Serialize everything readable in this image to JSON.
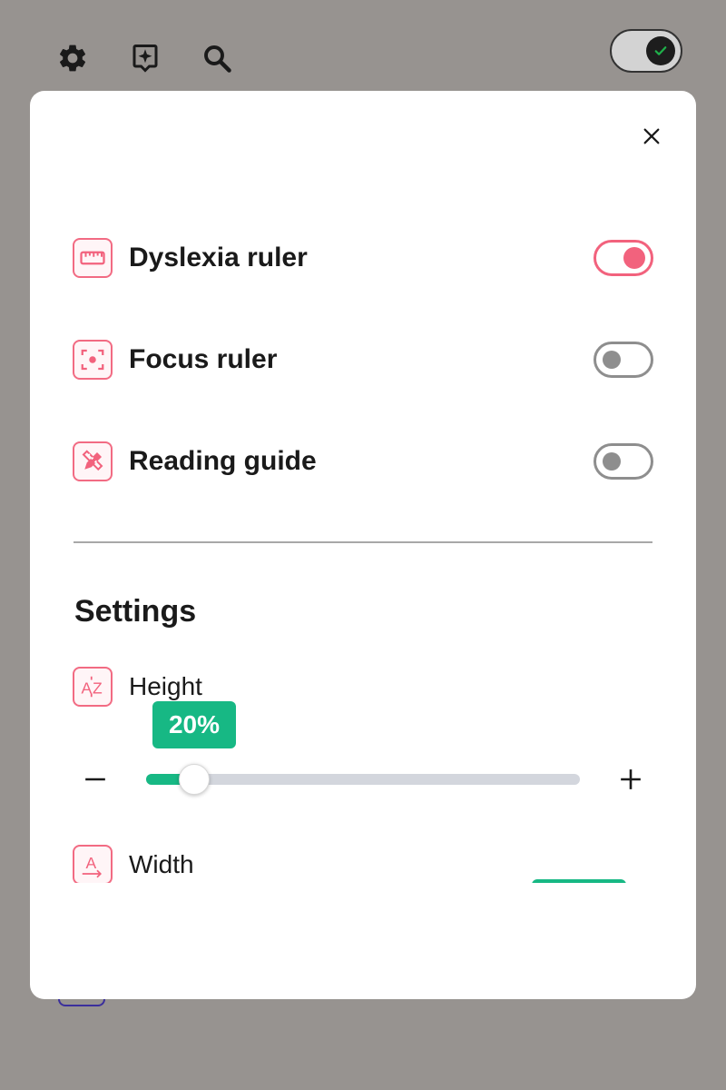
{
  "toolbar": {
    "icons": [
      "gear-icon",
      "sparkle-bubble-icon",
      "search-icon"
    ],
    "main_toggle_state": "on"
  },
  "modal": {
    "close_icon": "close-icon",
    "features": [
      {
        "label": "Dyslexia ruler",
        "icon": "ruler-icon",
        "enabled": true
      },
      {
        "label": "Focus ruler",
        "icon": "focus-target-icon",
        "enabled": false
      },
      {
        "label": "Reading guide",
        "icon": "pencil-ruler-icon",
        "enabled": false
      }
    ],
    "settings": {
      "title": "Settings",
      "height": {
        "label": "Height",
        "icon": "text-height-icon",
        "value_text": "20%",
        "value": 0.11
      },
      "width": {
        "label": "Width",
        "icon": "text-width-icon"
      }
    }
  },
  "colors": {
    "accent": "#f2627d",
    "slider": "#17b884",
    "track": "#d3d6dd",
    "backdrop": "#979390"
  }
}
